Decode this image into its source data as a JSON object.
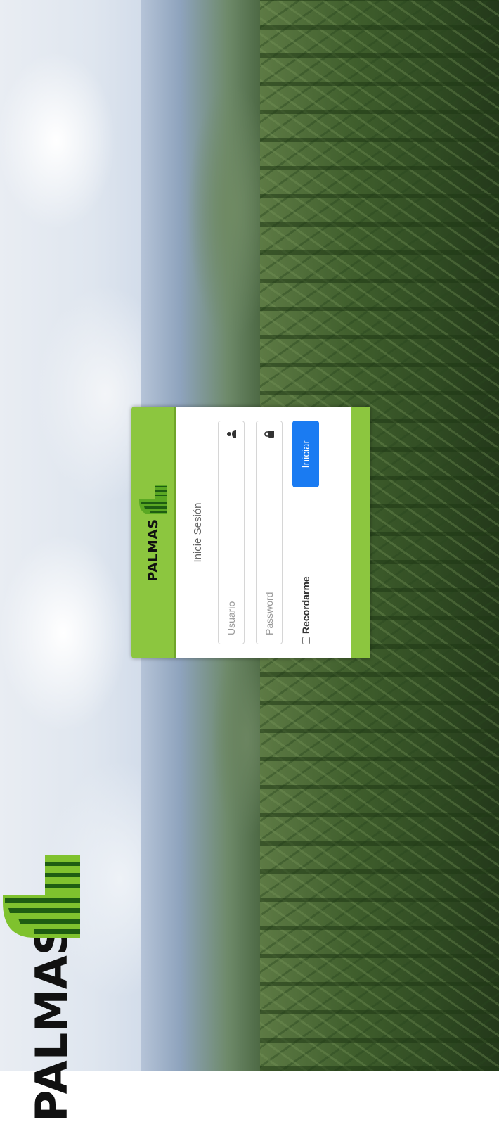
{
  "brand": {
    "name": "PALMAS",
    "accent": "#8cc63f",
    "button_color": "#1a7bf2"
  },
  "login": {
    "title": "Inicie Sesión",
    "username_placeholder": "Usuario",
    "password_placeholder": "Password",
    "username_icon": "user-icon",
    "password_icon": "lock-icon",
    "remember_label": "Recordarme",
    "submit_label": "Iniciar"
  }
}
